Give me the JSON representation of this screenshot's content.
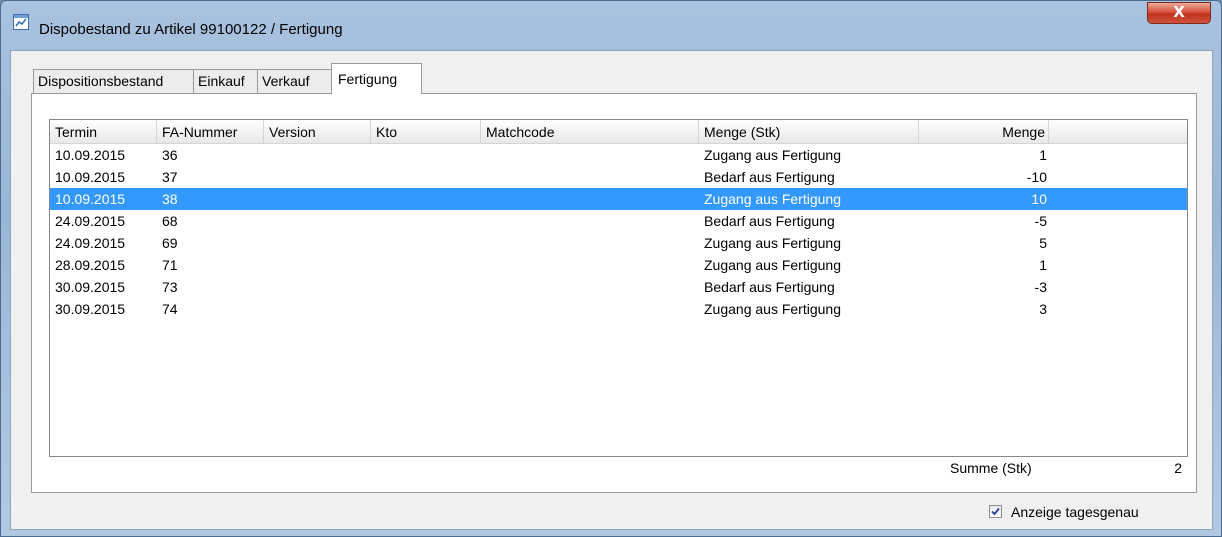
{
  "window": {
    "title": "Dispobestand zu Artikel 99100122 / Fertigung",
    "close_label": "X"
  },
  "tabs": [
    {
      "label": "Dispositionsbestand"
    },
    {
      "label": "Einkauf"
    },
    {
      "label": "Verkauf"
    },
    {
      "label": "Fertigung",
      "active": true
    }
  ],
  "table": {
    "columns": [
      "Termin",
      "FA-Nummer",
      "Version",
      "Kto",
      "Matchcode",
      "Menge (Stk)",
      "Menge"
    ],
    "rows": [
      {
        "termin": "10.09.2015",
        "fa_nummer": "36",
        "version": "",
        "kto": "",
        "matchcode": "",
        "menge_stk": "Zugang aus Fertigung",
        "menge": "1"
      },
      {
        "termin": "10.09.2015",
        "fa_nummer": "37",
        "version": "",
        "kto": "",
        "matchcode": "",
        "menge_stk": "Bedarf aus Fertigung",
        "menge": "-10"
      },
      {
        "termin": "10.09.2015",
        "fa_nummer": "38",
        "version": "",
        "kto": "",
        "matchcode": "",
        "menge_stk": "Zugang aus Fertigung",
        "menge": "10",
        "selected": true
      },
      {
        "termin": "24.09.2015",
        "fa_nummer": "68",
        "version": "",
        "kto": "",
        "matchcode": "",
        "menge_stk": "Bedarf aus Fertigung",
        "menge": "-5"
      },
      {
        "termin": "24.09.2015",
        "fa_nummer": "69",
        "version": "",
        "kto": "",
        "matchcode": "",
        "menge_stk": "Zugang aus Fertigung",
        "menge": "5"
      },
      {
        "termin": "28.09.2015",
        "fa_nummer": "71",
        "version": "",
        "kto": "",
        "matchcode": "",
        "menge_stk": "Zugang aus Fertigung",
        "menge": "1"
      },
      {
        "termin": "30.09.2015",
        "fa_nummer": "73",
        "version": "",
        "kto": "",
        "matchcode": "",
        "menge_stk": "Bedarf aus Fertigung",
        "menge": "-3"
      },
      {
        "termin": "30.09.2015",
        "fa_nummer": "74",
        "version": "",
        "kto": "",
        "matchcode": "",
        "menge_stk": "Zugang aus Fertigung",
        "menge": "3"
      }
    ]
  },
  "summary": {
    "label": "Summe (Stk)",
    "value": "2"
  },
  "option": {
    "label": "Anzeige tagesgenau",
    "checked": true
  },
  "colors": {
    "selection": "#3399ff",
    "close_button": "#c0321c"
  },
  "icons": {
    "app": "chart-window-icon",
    "checkbox": "checkmark-icon"
  }
}
